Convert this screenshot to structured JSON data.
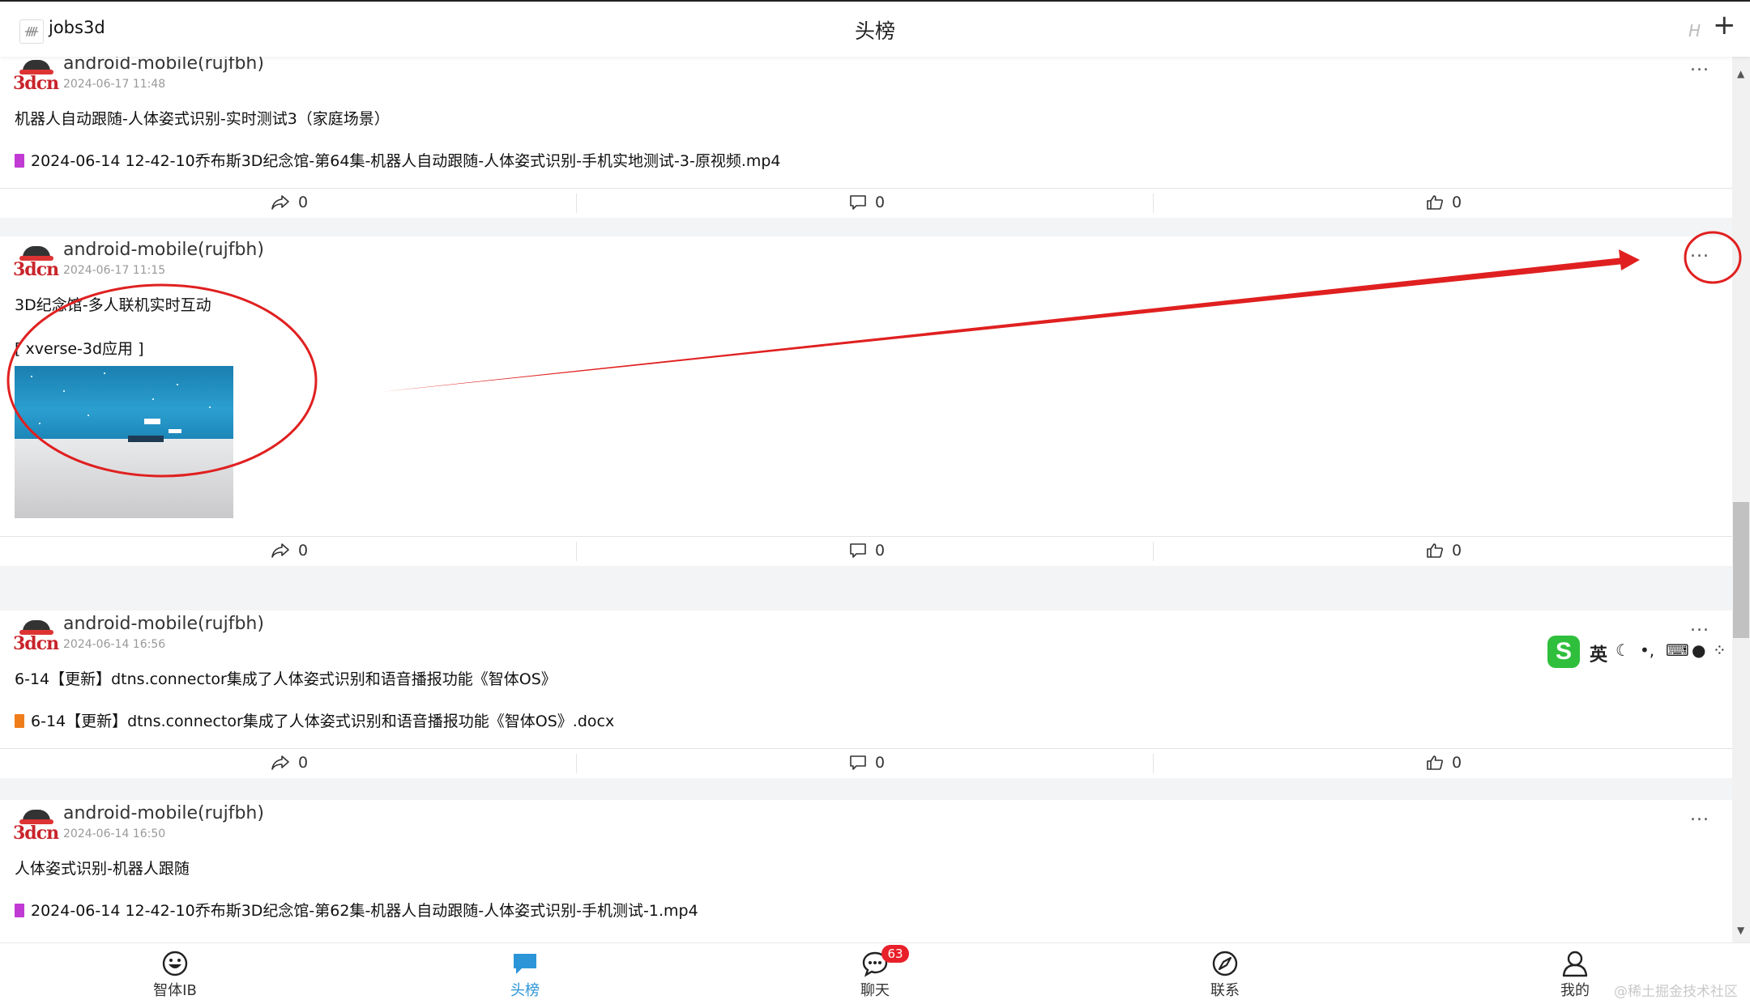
{
  "header": {
    "app_name": "jobs3d",
    "title": "头榜",
    "h_mark": "H",
    "plus_icon": "+",
    "logo_icon": "ᚎ"
  },
  "avatar_text": "3dcn",
  "more_label": "...",
  "posts": [
    {
      "author": "android-mobile(rujfbh)",
      "time": "2024-06-17 11:48",
      "text": "机器人自动跟随-人体姿式识别-实时测试3（家庭场景）",
      "file": "2024-06-14 12-42-10乔布斯3D纪念馆-第64集-机器人自动跟随-人体姿式识别-手机实地测试-3-原视频.mp4",
      "file_color": "#c03ad3",
      "shares": "0",
      "comments": "0",
      "likes": "0"
    },
    {
      "author": "android-mobile(rujfbh)",
      "time": "2024-06-17 11:15",
      "text": "3D纪念馆-多人联机实时互动",
      "link": "[ xverse-3d应用 ]",
      "shares": "0",
      "comments": "0",
      "likes": "0"
    },
    {
      "author": "android-mobile(rujfbh)",
      "time": "2024-06-14 16:56",
      "text": "6-14【更新】dtns.connector集成了人体姿式识别和语音播报功能《智体OS》",
      "file": "6-14【更新】dtns.connector集成了人体姿式识别和语音播报功能《智体OS》.docx",
      "file_color": "#ef7d1a",
      "shares": "0",
      "comments": "0",
      "likes": "0"
    },
    {
      "author": "android-mobile(rujfbh)",
      "time": "2024-06-14 16:50",
      "text": "人体姿式识别-机器人跟随",
      "file": "2024-06-14 12-42-10乔布斯3D纪念馆-第62集-机器人自动跟随-人体姿式识别-手机测试-1.mp4",
      "file_color": "#c03ad3"
    }
  ],
  "ime": {
    "lang": "英",
    "logo": "S"
  },
  "tabs": [
    {
      "label": "智体IB",
      "icon": "smiley-icon"
    },
    {
      "label": "头榜",
      "icon": "chat-bubble-icon",
      "active": true
    },
    {
      "label": "聊天",
      "icon": "chat-icon",
      "badge": "63"
    },
    {
      "label": "联系",
      "icon": "compass-icon"
    },
    {
      "label": "我的",
      "icon": "person-icon"
    }
  ],
  "watermark": "@稀土掘金技术社区",
  "colors": {
    "accent": "#2b95d8",
    "badge": "#e8202a",
    "annotation": "#e02020",
    "brand_red": "#c9242b"
  }
}
